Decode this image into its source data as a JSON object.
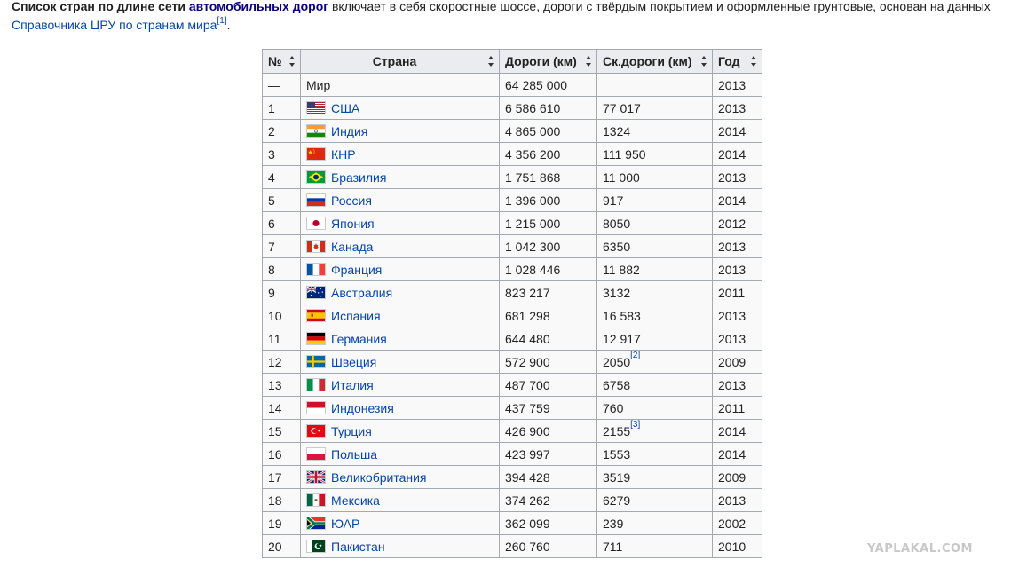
{
  "caption": {
    "bold_text": "Список стран по длине сети",
    "link_text": "автомобильных дорог",
    "rest_text": "включает в себя скоростные шоссе, дороги с твёрдым покрытием и оформленные грунтовые, основан на данных",
    "source_link": "Справочника ЦРУ по странам мира",
    "ref": "[1]",
    "end": "."
  },
  "table": {
    "headers": {
      "num": "№",
      "country": "Страна",
      "roads": "Дороги (км)",
      "highways": "Ск.дороги (км)",
      "year": "Год"
    },
    "rows": [
      {
        "num": "—",
        "country": "Мир",
        "flag": "none",
        "roads": "64 285 000",
        "highways": "",
        "ref": "",
        "year": "2013"
      },
      {
        "num": "1",
        "country": "США",
        "flag": "usa-flag-icon",
        "roads": "6 586 610",
        "highways": "77 017",
        "ref": "",
        "year": "2013"
      },
      {
        "num": "2",
        "country": "Индия",
        "flag": "india-flag-icon",
        "roads": "4 865 000",
        "highways": "1324",
        "ref": "",
        "year": "2014"
      },
      {
        "num": "3",
        "country": "КНР",
        "flag": "china-flag-icon",
        "roads": "4 356 200",
        "highways": "111 950",
        "ref": "",
        "year": "2014"
      },
      {
        "num": "4",
        "country": "Бразилия",
        "flag": "brazil-flag-icon",
        "roads": "1 751 868",
        "highways": "11 000",
        "ref": "",
        "year": "2013"
      },
      {
        "num": "5",
        "country": "Россия",
        "flag": "russia-flag-icon",
        "roads": "1 396 000",
        "highways": "917",
        "ref": "",
        "year": "2014"
      },
      {
        "num": "6",
        "country": "Япония",
        "flag": "japan-flag-icon",
        "roads": "1 215 000",
        "highways": "8050",
        "ref": "",
        "year": "2012"
      },
      {
        "num": "7",
        "country": "Канада",
        "flag": "canada-flag-icon",
        "roads": "1 042 300",
        "highways": "6350",
        "ref": "",
        "year": "2013"
      },
      {
        "num": "8",
        "country": "Франция",
        "flag": "france-flag-icon",
        "roads": "1 028 446",
        "highways": "11 882",
        "ref": "",
        "year": "2013"
      },
      {
        "num": "9",
        "country": "Австралия",
        "flag": "australia-flag-icon",
        "roads": "823 217",
        "highways": "3132",
        "ref": "",
        "year": "2011"
      },
      {
        "num": "10",
        "country": "Испания",
        "flag": "spain-flag-icon",
        "roads": "681 298",
        "highways": "16 583",
        "ref": "",
        "year": "2013"
      },
      {
        "num": "11",
        "country": "Германия",
        "flag": "germany-flag-icon",
        "roads": "644 480",
        "highways": "12 917",
        "ref": "",
        "year": "2013"
      },
      {
        "num": "12",
        "country": "Швеция",
        "flag": "sweden-flag-icon",
        "roads": "572 900",
        "highways": "2050",
        "ref": "[2]",
        "year": "2009"
      },
      {
        "num": "13",
        "country": "Италия",
        "flag": "italy-flag-icon",
        "roads": "487 700",
        "highways": "6758",
        "ref": "",
        "year": "2013"
      },
      {
        "num": "14",
        "country": "Индонезия",
        "flag": "indonesia-flag-icon",
        "roads": "437 759",
        "highways": "760",
        "ref": "",
        "year": "2011"
      },
      {
        "num": "15",
        "country": "Турция",
        "flag": "turkey-flag-icon",
        "roads": "426 900",
        "highways": "2155",
        "ref": "[3]",
        "year": "2014"
      },
      {
        "num": "16",
        "country": "Польша",
        "flag": "poland-flag-icon",
        "roads": "423 997",
        "highways": "1553",
        "ref": "",
        "year": "2014"
      },
      {
        "num": "17",
        "country": "Великобритания",
        "flag": "uk-flag-icon",
        "roads": "394 428",
        "highways": "3519",
        "ref": "",
        "year": "2009"
      },
      {
        "num": "18",
        "country": "Мексика",
        "flag": "mexico-flag-icon",
        "roads": "374 262",
        "highways": "6279",
        "ref": "",
        "year": "2013"
      },
      {
        "num": "19",
        "country": "ЮАР",
        "flag": "south-africa-flag-icon",
        "roads": "362 099",
        "highways": "239",
        "ref": "",
        "year": "2002"
      },
      {
        "num": "20",
        "country": "Пакистан",
        "flag": "pakistan-flag-icon",
        "roads": "260 760",
        "highways": "711",
        "ref": "",
        "year": "2010"
      }
    ]
  },
  "watermark": "YAPLAKAL.COM",
  "colors": {
    "link": "#0645ad",
    "bold_link": "#0b0080",
    "header_bg": "#eaecf0",
    "cell_bg": "#f9f9f9",
    "border": "#a2a9b1"
  }
}
